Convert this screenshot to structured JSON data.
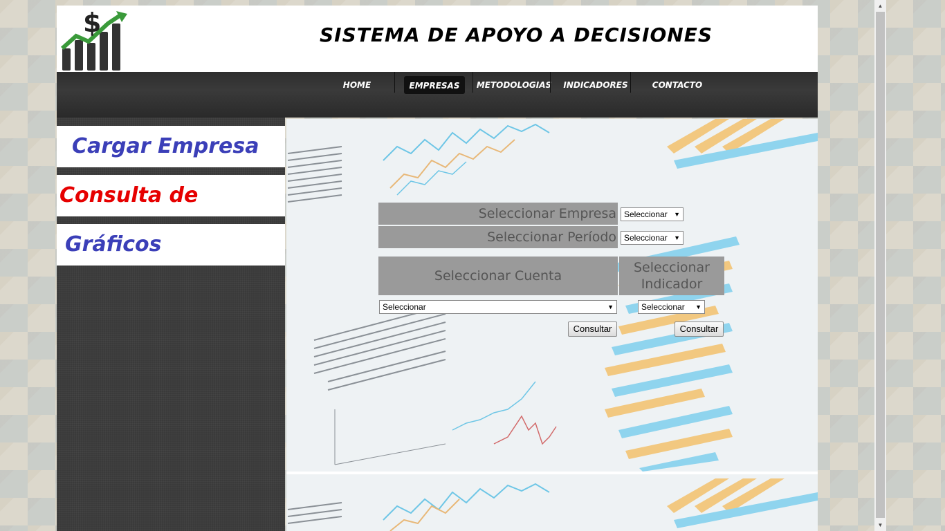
{
  "header": {
    "title": "SISTEMA DE APOYO A DECISIONES",
    "logo_icon": "dollar-chart-logo-icon"
  },
  "nav": {
    "items": [
      {
        "label": "HOME"
      },
      {
        "label": "EMPRESAS"
      },
      {
        "label": "METODOLOGIAS"
      },
      {
        "label": "INDICADORES"
      },
      {
        "label": "CONTACTO"
      }
    ],
    "active": "EMPRESAS"
  },
  "sidebar": {
    "items": [
      {
        "label": "Cargar Empresa",
        "color": "#3b3fb8"
      },
      {
        "label": "Consulta de Valores",
        "color": "#e60000"
      },
      {
        "label": "Gráficos",
        "color": "#3b3fb8"
      }
    ]
  },
  "form": {
    "empresa_label": "Seleccionar Empresa",
    "empresa_select": "Seleccionar",
    "periodo_label": "Seleccionar Período",
    "periodo_select": "Seleccionar",
    "cuenta_label": "Seleccionar Cuenta",
    "indicador_label": "Seleccionar Indicador",
    "cuenta_select": "Seleccionar",
    "indicador_select": "Seleccionar",
    "consultar_cuenta": "Consultar",
    "consultar_indicador": "Consultar"
  },
  "colors": {
    "label_box": "#9a9a9a",
    "nav_bg": "#2e2e2e"
  }
}
